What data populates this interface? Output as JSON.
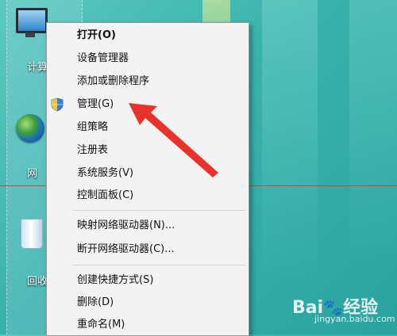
{
  "desktop": {
    "icons": [
      {
        "label": "计算",
        "name": "computer"
      },
      {
        "label": "网",
        "name": "network"
      },
      {
        "label": "回收",
        "name": "recycle-bin"
      }
    ]
  },
  "context_menu": {
    "items": [
      {
        "label": "打开(O)",
        "bold": true
      },
      {
        "label": "设备管理器"
      },
      {
        "label": "添加或删除程序"
      },
      {
        "label": "管理(G)",
        "icon": "uac-shield-icon"
      },
      {
        "label": "组策略"
      },
      {
        "label": "注册表"
      },
      {
        "label": "系统服务(V)"
      },
      {
        "label": "控制面板(C)"
      },
      {
        "label": "映射网络驱动器(N)..."
      },
      {
        "label": "断开网络驱动器(C)..."
      },
      {
        "label": "创建快捷方式(S)"
      },
      {
        "label": "删除(D)"
      },
      {
        "label": "重命名(M)"
      }
    ]
  },
  "annotation": {
    "arrow_color": "#e8322b"
  },
  "watermark": {
    "text": "Bai",
    "suffix": "经验",
    "sub": "jingyan.baidu.com"
  }
}
